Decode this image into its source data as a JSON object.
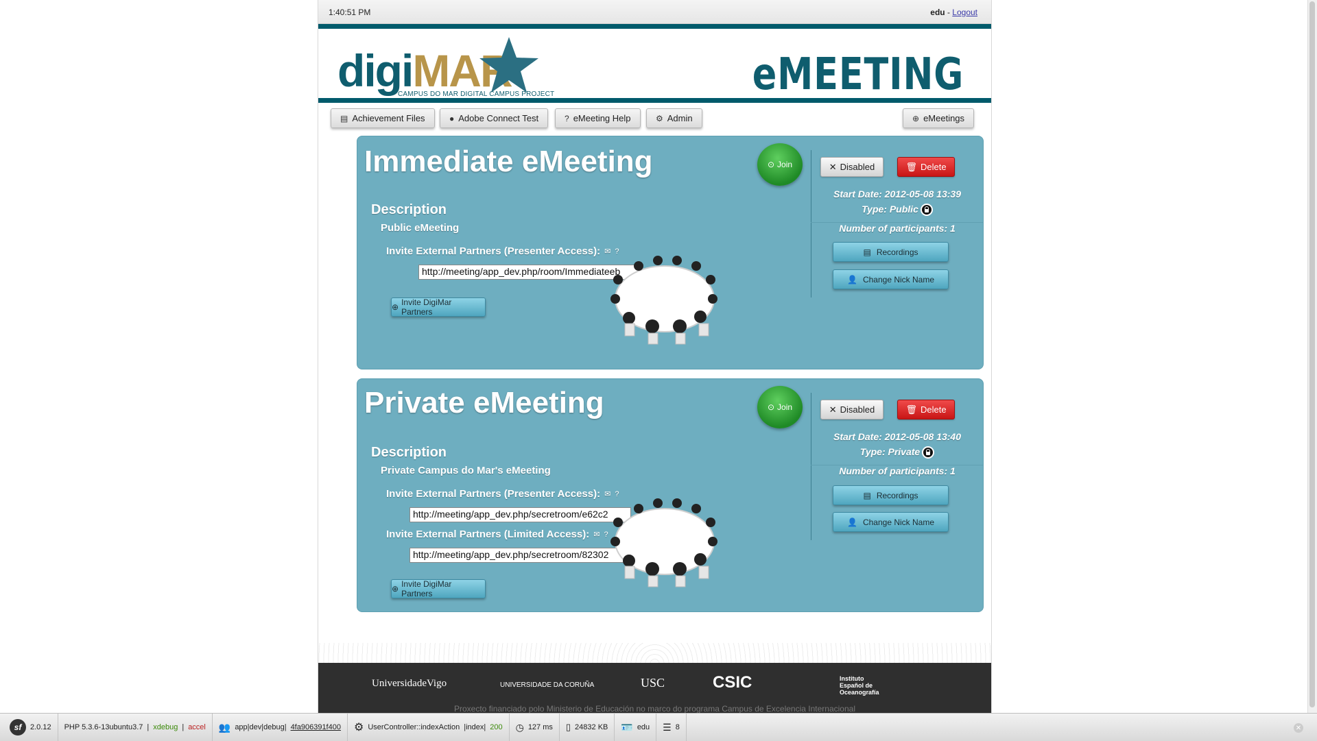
{
  "topbar": {
    "time": "1:40:51 PM",
    "user": "edu",
    "separator": " - ",
    "logout": "Logout"
  },
  "header": {
    "logo_digi": "digi",
    "logo_mar": "MAR",
    "logo_tagline": "CAMPUS DO MAR DIGITAL CAMPUS PROJECT",
    "title": "eMEETING"
  },
  "nav": {
    "achievement": "Achievement Files",
    "adobe": "Adobe Connect Test",
    "help": "eMeeting Help",
    "admin": "Admin",
    "emeetings": "eMeetings"
  },
  "meetings": [
    {
      "title": "Immediate eMeeting",
      "join": "Join",
      "disabled": "Disabled",
      "delete": "Delete",
      "start_date": "Start Date: 2012-05-08 13:39",
      "type": "Type: Public",
      "participants": "Number of participants: 1",
      "recordings": "Recordings",
      "nick": "Change Nick Name",
      "desc_heading": "Description",
      "desc_text": "Public eMeeting",
      "invite_presenter_label": "Invite External Partners (Presenter Access):",
      "invite_presenter_url": "http://meeting/app_dev.php/room/Immediateeb",
      "invite_btn": "Invite DigiMar Partners"
    },
    {
      "title": "Private eMeeting",
      "join": "Join",
      "disabled": "Disabled",
      "delete": "Delete",
      "start_date": "Start Date: 2012-05-08 13:40",
      "type": "Type: Private",
      "participants": "Number of participants: 1",
      "recordings": "Recordings",
      "nick": "Change Nick Name",
      "desc_heading": "Description",
      "desc_text": "Private Campus do Mar's eMeeting",
      "invite_presenter_label": "Invite External Partners (Presenter Access):",
      "invite_presenter_url": "http://meeting/app_dev.php/secretroom/e62c2",
      "invite_limited_label": "Invite External Partners (Limited Access):",
      "invite_limited_url": "http://meeting/app_dev.php/secretroom/82302",
      "invite_btn": "Invite DigiMar Partners"
    }
  ],
  "footer": {
    "uvigo": "UniversidadeVigo",
    "udc": "UNIVERSIDADE DA CORUÑA",
    "usc": "USC",
    "csic": "CSIC",
    "ieo": "Instituto Español de Oceanografía",
    "note": "Proxecto financiado polo Ministerio de Educación no marco do programa Campus de Excelencia Internacional"
  },
  "symfony_bar": {
    "version": "2.0.12",
    "php": "PHP 5.3.6-13ubuntu3.7",
    "xdebug": "xdebug",
    "accel": "accel",
    "env": "app|dev|debug|",
    "token": "4fa906391f400",
    "controller": "UserController::indexAction",
    "route": "|index|",
    "status": "200",
    "time": "127 ms",
    "memory": "24832 KB",
    "user": "edu",
    "queries": "8"
  }
}
